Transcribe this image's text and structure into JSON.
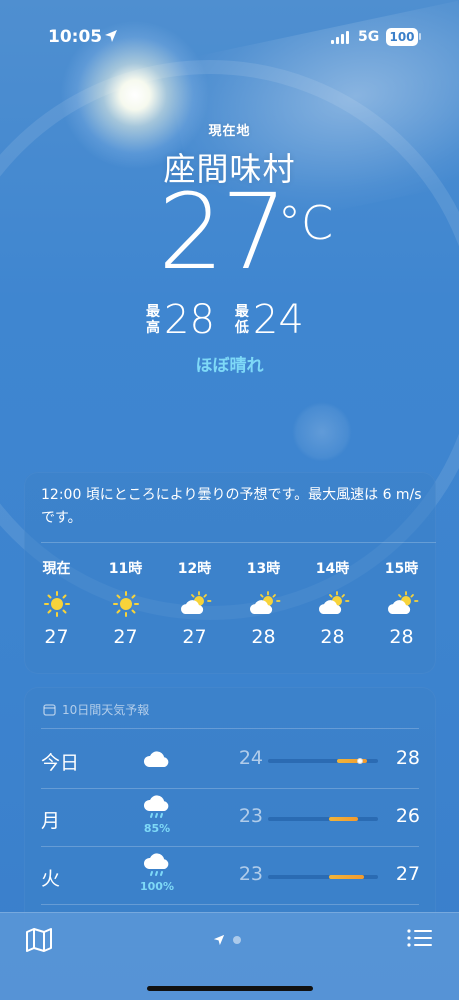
{
  "status_bar": {
    "time": "10:05",
    "network": "5G",
    "battery": "100"
  },
  "current": {
    "location_label": "現在地",
    "city": "座間味村",
    "temperature": "27",
    "unit": "°C",
    "high_label_1": "最",
    "high_label_2": "高",
    "high": "28",
    "low_label_1": "最",
    "low_label_2": "低",
    "low": "24",
    "condition": "ほぼ晴れ"
  },
  "hourly": {
    "summary": "12:00 頃にところにより曇りの予想です。最大風速は 6 m/s です。",
    "items": [
      {
        "label": "現在",
        "icon": "sun-icon",
        "temp": "27"
      },
      {
        "label": "11時",
        "icon": "sun-icon",
        "temp": "27"
      },
      {
        "label": "12時",
        "icon": "partly-cloudy-icon",
        "temp": "27"
      },
      {
        "label": "13時",
        "icon": "partly-cloudy-icon",
        "temp": "28"
      },
      {
        "label": "14時",
        "icon": "partly-cloudy-icon",
        "temp": "28"
      },
      {
        "label": "15時",
        "icon": "partly-cloudy-icon",
        "temp": "28"
      }
    ]
  },
  "daily": {
    "header": "10日間天気予報",
    "days": [
      {
        "name": "今日",
        "icon": "cloud-icon",
        "precip": "",
        "low": "24",
        "high": "28",
        "bar_start": 0.63,
        "bar_end": 0.9,
        "current_pos": 0.84
      },
      {
        "name": "月",
        "icon": "rain-cloud-icon",
        "precip": "85%",
        "low": "23",
        "high": "26",
        "bar_start": 0.55,
        "bar_end": 0.82
      },
      {
        "name": "火",
        "icon": "rain-cloud-icon",
        "precip": "100%",
        "low": "23",
        "high": "27",
        "bar_start": 0.55,
        "bar_end": 0.87
      }
    ]
  },
  "colors": {
    "accent_condition": "#7ed9f7",
    "temp_bar": "#f0b43a"
  }
}
